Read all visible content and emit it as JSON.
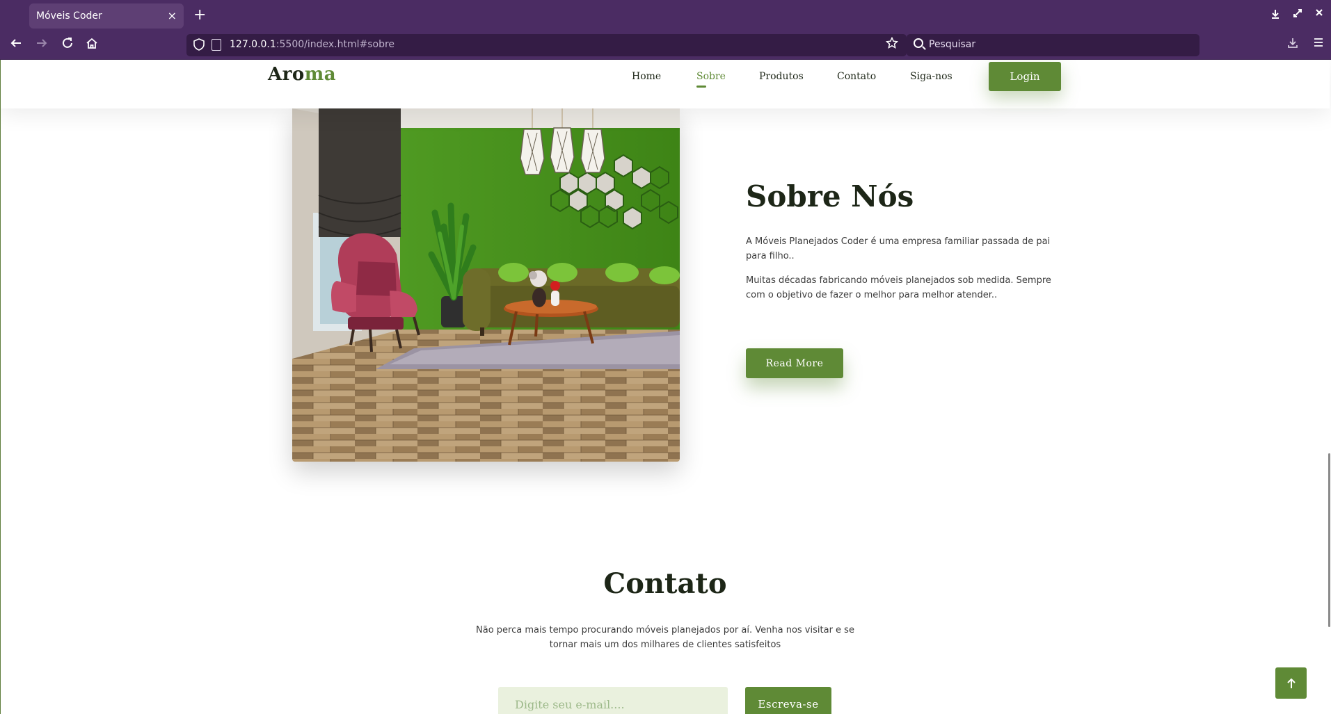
{
  "browser": {
    "tab_title": "Móveis Coder",
    "tab_close": "×",
    "new_tab": "+",
    "url_host": "127.0.0.1",
    "url_path": ":5500/index.html#sobre",
    "search_placeholder": "Pesquisar",
    "icons": [
      "back-icon",
      "forward-icon",
      "reload-icon",
      "home-icon",
      "shield-icon",
      "page-icon",
      "star-icon",
      "search-icon",
      "download-icon",
      "menu-icon",
      "minimize-icon",
      "maximize-icon",
      "close-icon"
    ]
  },
  "header": {
    "logo_main": "Aro",
    "logo_accent": "ma",
    "nav": [
      "Home",
      "Sobre",
      "Produtos",
      "Contato",
      "Siga-nos"
    ],
    "active_nav": "Sobre",
    "login_label": "Login"
  },
  "about": {
    "title": "Sobre Nós",
    "paragraph1": "A Móveis Planejados Coder é uma empresa familiar passada de pai para filho..",
    "paragraph2": "Muitas décadas fabricando móveis planejados sob medida. Sempre com o objetivo de fazer o melhor para melhor atender..",
    "button_label": "Read More"
  },
  "contact": {
    "title": "Contato",
    "paragraph": "Não perca mais tempo procurando móveis planejados por aí. Venha nos visitar e se tornar mais um dos milhares de clientes satisfeitos",
    "email_placeholder": "Digite seu e-mail....",
    "subscribe_label": "Escreva-se"
  },
  "colors": {
    "browser_chrome": "#4b2c63",
    "brand_green": "#5f8a36",
    "dark_text": "#1d2617"
  }
}
